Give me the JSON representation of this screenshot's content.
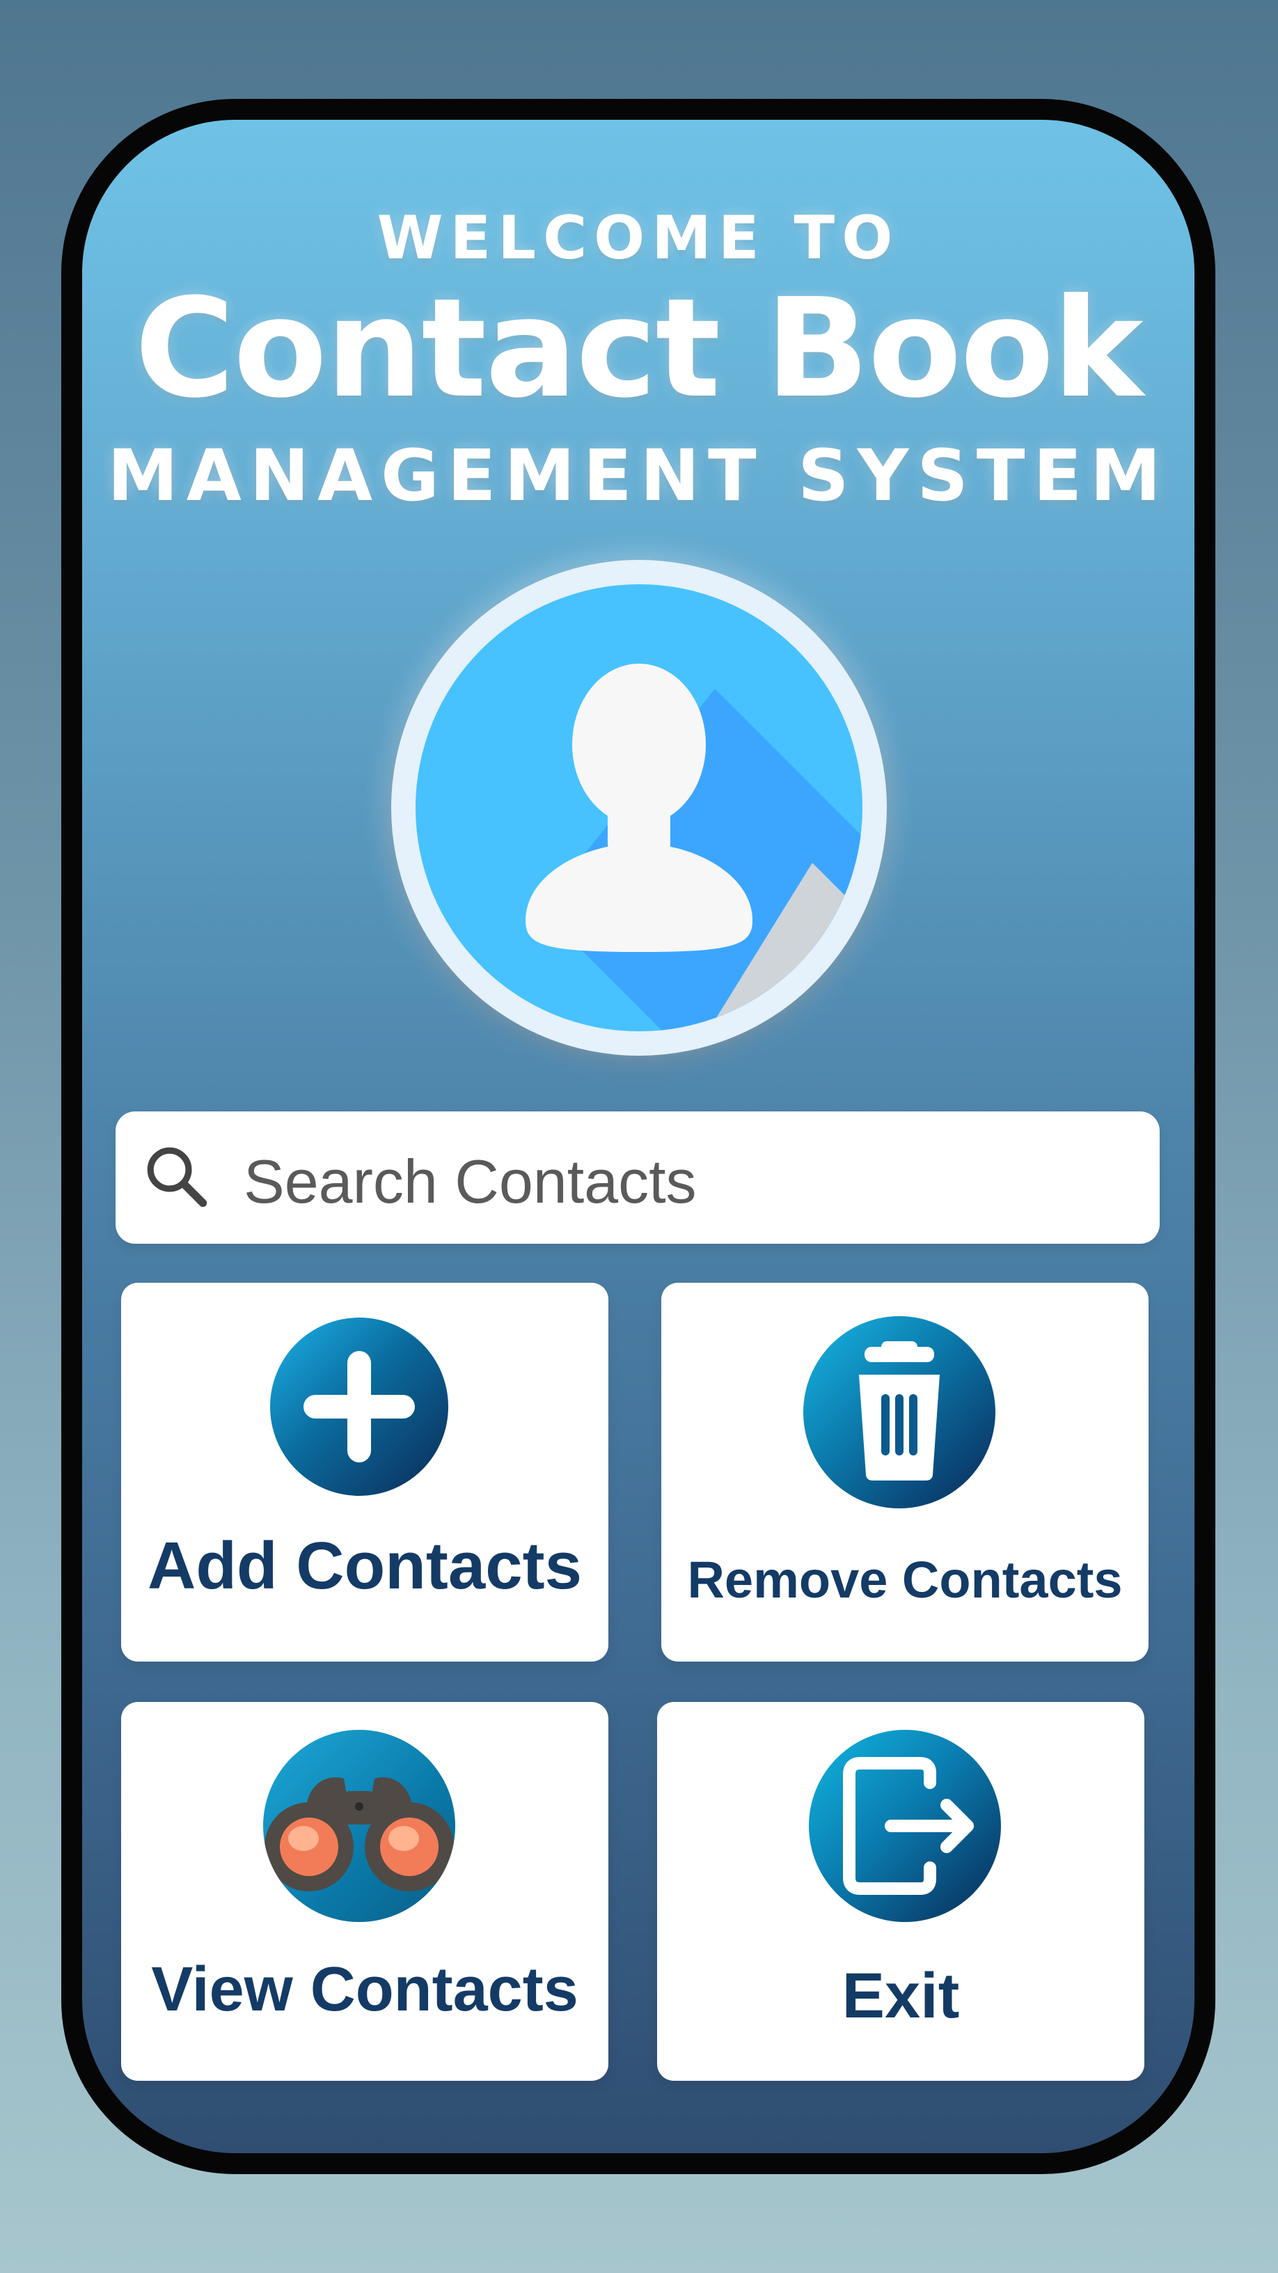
{
  "header": {
    "welcome": "WELCOME TO",
    "title": "Contact Book",
    "subtitle": "MANAGEMENT SYSTEM"
  },
  "search": {
    "placeholder": "Search Contacts",
    "icon": "search-icon"
  },
  "actions": [
    {
      "label": "Add Contacts",
      "icon": "add-icon"
    },
    {
      "label": "Remove Contacts",
      "icon": "trash-icon"
    },
    {
      "label": "View Contacts",
      "icon": "binoculars-icon"
    },
    {
      "label": "Exit",
      "icon": "exit-icon"
    }
  ],
  "colors": {
    "accent_blue": "#47C2FF",
    "label_navy": "#143B66",
    "frame": "#060606"
  }
}
